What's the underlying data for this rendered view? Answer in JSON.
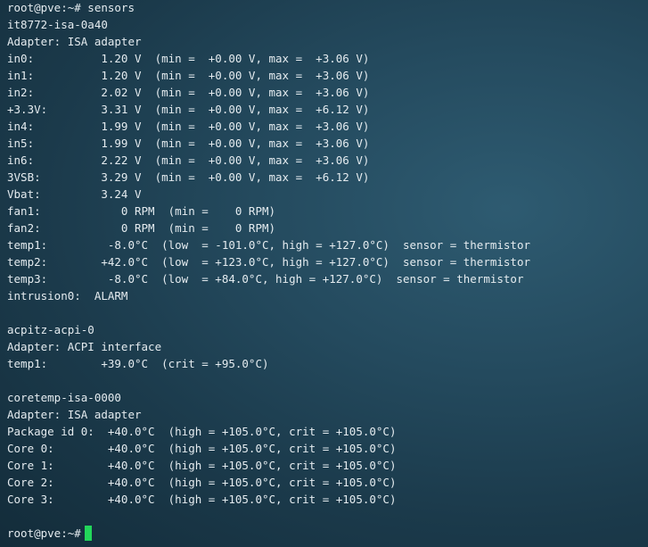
{
  "terminal": {
    "lines": [
      "root@pve:~# sensors",
      "it8772-isa-0a40",
      "Adapter: ISA adapter",
      "in0:          1.20 V  (min =  +0.00 V, max =  +3.06 V)",
      "in1:          1.20 V  (min =  +0.00 V, max =  +3.06 V)",
      "in2:          2.02 V  (min =  +0.00 V, max =  +3.06 V)",
      "+3.3V:        3.31 V  (min =  +0.00 V, max =  +6.12 V)",
      "in4:          1.99 V  (min =  +0.00 V, max =  +3.06 V)",
      "in5:          1.99 V  (min =  +0.00 V, max =  +3.06 V)",
      "in6:          2.22 V  (min =  +0.00 V, max =  +3.06 V)",
      "3VSB:         3.29 V  (min =  +0.00 V, max =  +6.12 V)",
      "Vbat:         3.24 V",
      "fan1:            0 RPM  (min =    0 RPM)",
      "fan2:            0 RPM  (min =    0 RPM)",
      "temp1:         -8.0°C  (low  = -101.0°C, high = +127.0°C)  sensor = thermistor",
      "temp2:        +42.0°C  (low  = +123.0°C, high = +127.0°C)  sensor = thermistor",
      "temp3:         -8.0°C  (low  = +84.0°C, high = +127.0°C)  sensor = thermistor",
      "intrusion0:  ALARM",
      "",
      "acpitz-acpi-0",
      "Adapter: ACPI interface",
      "temp1:        +39.0°C  (crit = +95.0°C)",
      "",
      "coretemp-isa-0000",
      "Adapter: ISA adapter",
      "Package id 0:  +40.0°C  (high = +105.0°C, crit = +105.0°C)",
      "Core 0:        +40.0°C  (high = +105.0°C, crit = +105.0°C)",
      "Core 1:        +40.0°C  (high = +105.0°C, crit = +105.0°C)",
      "Core 2:        +40.0°C  (high = +105.0°C, crit = +105.0°C)",
      "Core 3:        +40.0°C  (high = +105.0°C, crit = +105.0°C)",
      ""
    ],
    "final_prompt": "root@pve:~#"
  },
  "colors": {
    "text": "#e4ebef",
    "cursor": "#22d65a",
    "background": "#1e4052"
  }
}
